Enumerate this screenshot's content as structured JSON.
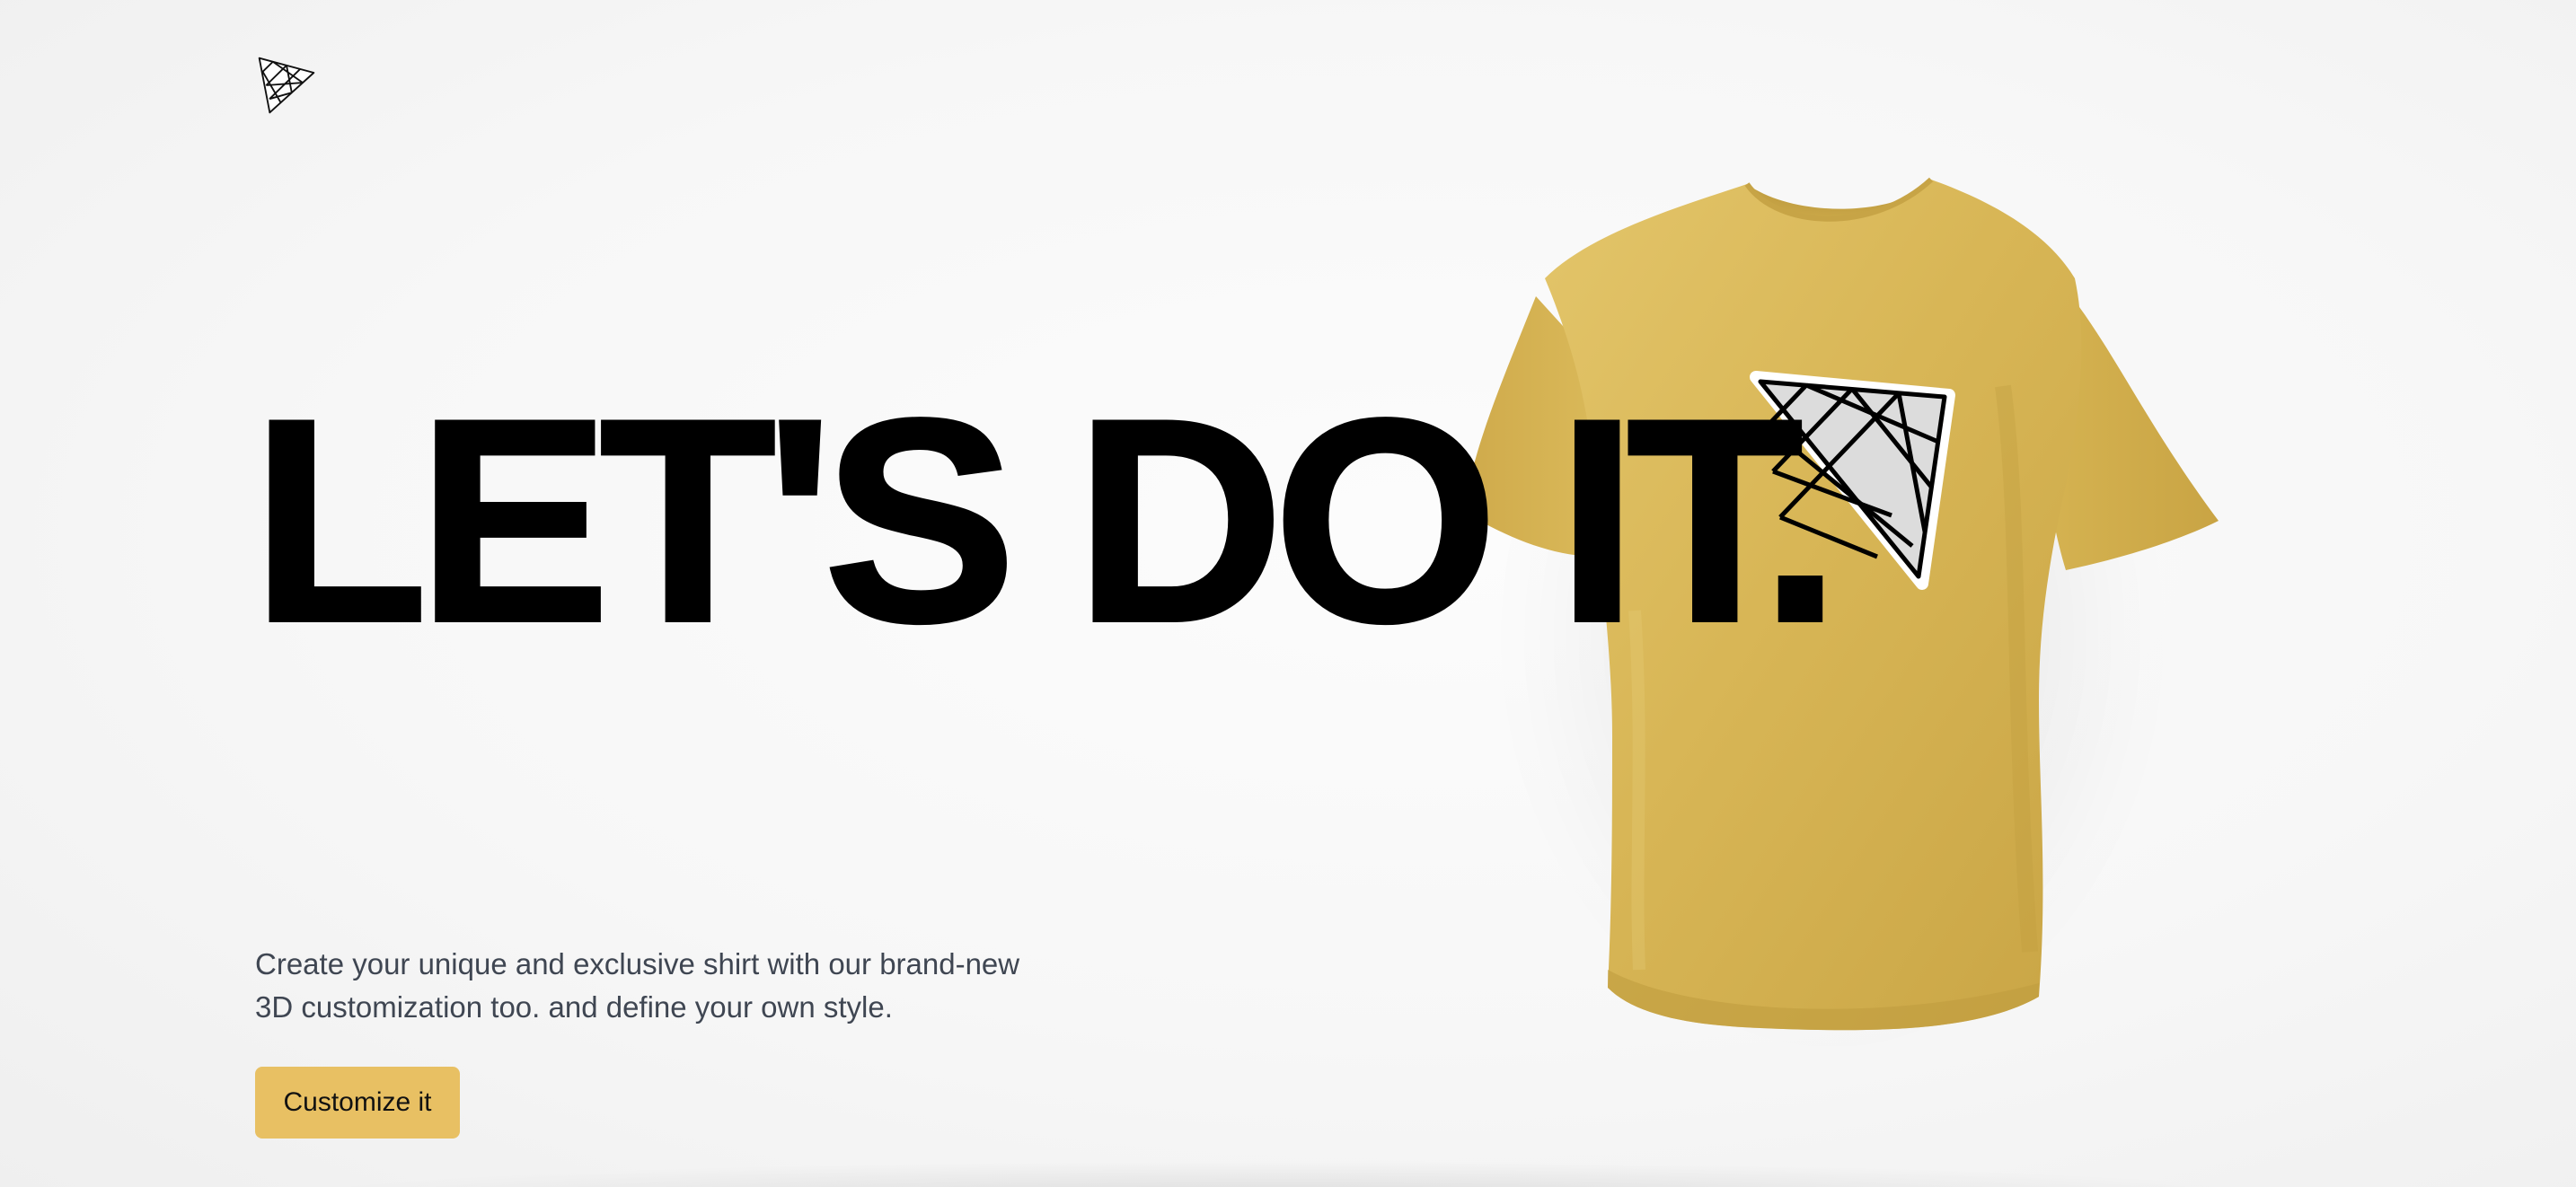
{
  "header": {
    "logo_icon": "triangle-mesh-logo-icon"
  },
  "hero": {
    "headline": "LET'S DO IT.",
    "description_line1": "Create your unique and exclusive shirt with our brand-new",
    "description_line2": "3D customization too. and define your own style.",
    "cta_label": "Customize it"
  },
  "product": {
    "image": "yellow-t-shirt-3d-model",
    "decal_icon": "triangle-mesh-decal-icon"
  },
  "colors": {
    "shirt": "#d9b656",
    "accent": "#e8c063",
    "text": "#000000",
    "muted_text": "#3f4652",
    "background": "#f6f6f6"
  }
}
